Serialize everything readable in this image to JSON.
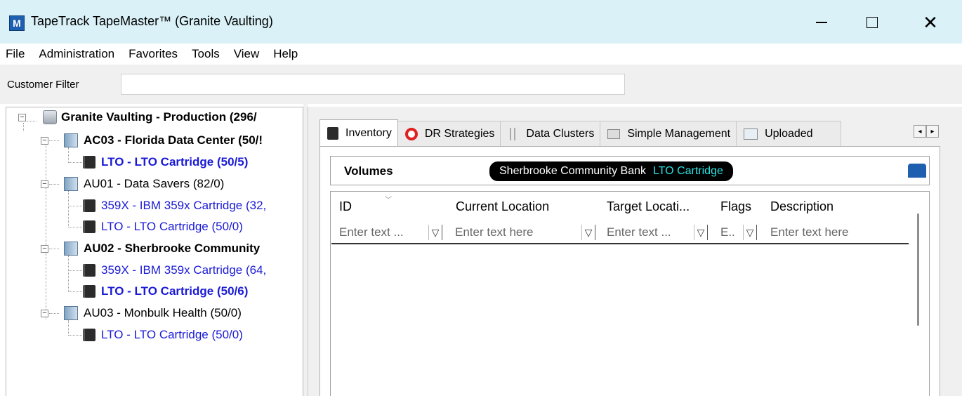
{
  "window": {
    "app_icon_letter": "M",
    "title": "TapeTrack TapeMaster™ (Granite Vaulting)",
    "minimize_glyph": "—",
    "maximize_glyph": "☐",
    "close_glyph": "✕"
  },
  "menu": {
    "items": [
      "File",
      "Administration",
      "Favorites",
      "Tools",
      "View",
      "Help"
    ]
  },
  "filter": {
    "label": "Customer Filter",
    "value": ""
  },
  "tree": {
    "root": {
      "label": "Granite Vaulting - Production (296/",
      "icon": "database-icon",
      "expanded": true
    },
    "customers": [
      {
        "label": "AC03 - Florida Data Center (50/!",
        "bold": true,
        "icon": "customer-icon",
        "media": [
          {
            "label": "LTO - LTO Cartridge (50/5)",
            "bold": true,
            "icon": "tape-icon"
          }
        ]
      },
      {
        "label": "AU01 - Data Savers (82/0)",
        "bold": false,
        "icon": "customer-icon",
        "media": [
          {
            "label": "359X - IBM 359x Cartridge (32,",
            "bold": false,
            "icon": "tape-icon"
          },
          {
            "label": "LTO - LTO Cartridge (50/0)",
            "bold": false,
            "icon": "tape-icon"
          }
        ]
      },
      {
        "label": "AU02 - Sherbrooke Community",
        "bold": true,
        "icon": "customer-icon",
        "media": [
          {
            "label": "359X - IBM 359x Cartridge (64,",
            "bold": false,
            "icon": "tape-icon"
          },
          {
            "label": "LTO - LTO Cartridge (50/6)",
            "bold": true,
            "icon": "tape-icon"
          }
        ]
      },
      {
        "label": "AU03 - Monbulk Health (50/0)",
        "bold": false,
        "icon": "customer-icon",
        "media": [
          {
            "label": "LTO - LTO Cartridge (50/0)",
            "bold": false,
            "icon": "tape-icon"
          }
        ]
      }
    ]
  },
  "tabs": [
    {
      "label": "Inventory",
      "icon": "inventory-icon",
      "active": true
    },
    {
      "label": "DR Strategies",
      "icon": "lifebuoy-icon",
      "active": false
    },
    {
      "label": "Data Clusters",
      "icon": "data-clusters-icon",
      "active": false
    },
    {
      "label": "Simple Management",
      "icon": "simple-management-icon",
      "active": false
    },
    {
      "label": "Uploaded",
      "icon": "upload-icon",
      "active": false
    }
  ],
  "tab_scroll": {
    "left": "◂",
    "right": "▸"
  },
  "volumes": {
    "label": "Volumes",
    "customer": "Sherbrooke Community Bank",
    "media": "LTO Cartridge"
  },
  "grid": {
    "columns": [
      {
        "header": "ID",
        "filter_placeholder": "Enter text ..."
      },
      {
        "header": "Current Location",
        "filter_placeholder": "Enter text here"
      },
      {
        "header": "Target Locati...",
        "filter_placeholder": "Enter text ..."
      },
      {
        "header": "Flags",
        "filter_placeholder": "E.."
      },
      {
        "header": "Description",
        "filter_placeholder": "Enter text here"
      }
    ],
    "rows": []
  },
  "colors": {
    "titlebar_bg": "#d9f1f7",
    "pill_bg": "#000000",
    "pill_media": "#27e3e3",
    "link_blue": "#1a1ad6"
  }
}
